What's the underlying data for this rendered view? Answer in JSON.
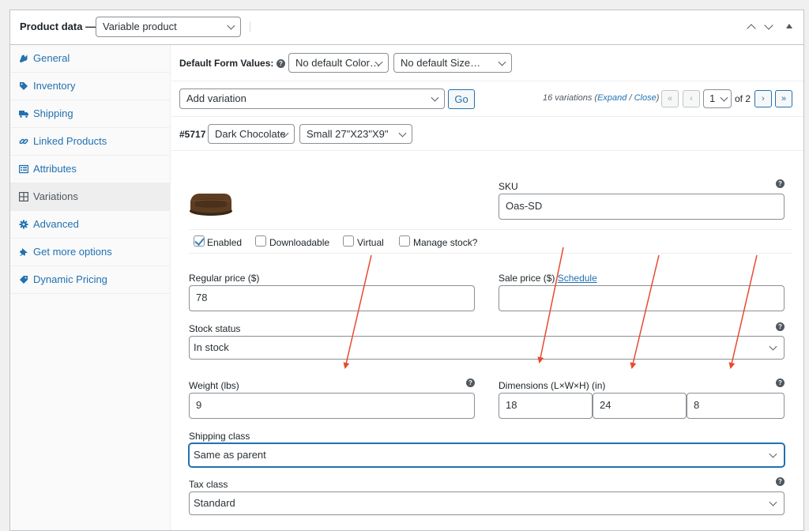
{
  "header": {
    "title": "Product data —",
    "product_type": "Variable product"
  },
  "sidebar": {
    "items": [
      {
        "label": "General",
        "icon": "wrench-icon"
      },
      {
        "label": "Inventory",
        "icon": "tag-icon"
      },
      {
        "label": "Shipping",
        "icon": "truck-icon"
      },
      {
        "label": "Linked Products",
        "icon": "link-icon"
      },
      {
        "label": "Attributes",
        "icon": "list-icon"
      },
      {
        "label": "Variations",
        "icon": "grid-icon"
      },
      {
        "label": "Advanced",
        "icon": "gear-icon"
      },
      {
        "label": "Get more options",
        "icon": "plugin-icon"
      },
      {
        "label": "Dynamic Pricing",
        "icon": "price-tag-icon"
      }
    ],
    "active": "Variations"
  },
  "defaults": {
    "label": "Default Form Values:",
    "color": "No default Color…",
    "size": "No default Size…"
  },
  "toolbar": {
    "action": "Add variation",
    "go": "Go",
    "count": "16 variations (",
    "expand": "Expand",
    "slash": " / ",
    "close": "Close",
    "paren": ")",
    "first": "«",
    "prev": "‹",
    "page": "1",
    "of": "of 2",
    "next": "›",
    "last": "»"
  },
  "variation": {
    "id": "#5717",
    "color": "Dark Chocolate",
    "size": "Small 27\"X23\"X9\"",
    "sku_label": "SKU",
    "sku": "Oas-SD",
    "enabled": "Enabled",
    "downloadable": "Downloadable",
    "virtual": "Virtual",
    "manage_stock": "Manage stock?",
    "regular_price_label": "Regular price ($)",
    "regular_price": "78",
    "sale_price_label": "Sale price ($)",
    "schedule": "Schedule",
    "sale_price": "",
    "stock_status_label": "Stock status",
    "stock_status": "In stock",
    "weight_label": "Weight (lbs)",
    "weight": "9",
    "dimensions_label": "Dimensions (L×W×H) (in)",
    "length": "18",
    "width": "24",
    "height": "8",
    "shipping_class_label": "Shipping class",
    "shipping_class": "Same as parent",
    "tax_class_label": "Tax class",
    "tax_class": "Standard"
  },
  "colors": {
    "accent": "#2271b1",
    "annotation_arrow": "#e8492f"
  }
}
